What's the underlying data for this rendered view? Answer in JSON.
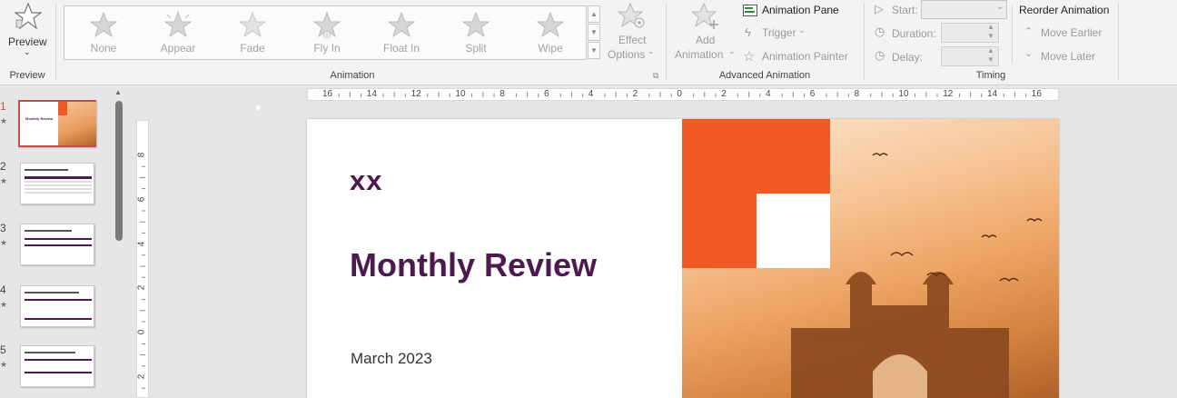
{
  "ribbon": {
    "preview": {
      "label": "Preview",
      "group": "Preview"
    },
    "animation": {
      "group": "Animation",
      "items": [
        {
          "label": "None"
        },
        {
          "label": "Appear"
        },
        {
          "label": "Fade"
        },
        {
          "label": "Fly In"
        },
        {
          "label": "Float In"
        },
        {
          "label": "Split"
        },
        {
          "label": "Wipe"
        }
      ],
      "effect_options": {
        "line1": "Effect",
        "line2": "Options"
      }
    },
    "advanced": {
      "group": "Advanced Animation",
      "add_animation": {
        "line1": "Add",
        "line2": "Animation"
      },
      "pane": "Animation Pane",
      "trigger": "Trigger",
      "painter": "Animation Painter"
    },
    "timing": {
      "group": "Timing",
      "start": "Start:",
      "duration": "Duration:",
      "delay": "Delay:",
      "start_value": "",
      "duration_value": "",
      "delay_value": ""
    },
    "reorder": {
      "title": "Reorder Animation",
      "earlier": "Move Earlier",
      "later": "Move Later"
    }
  },
  "thumbnails": [
    {
      "number": "1",
      "star": "★",
      "title": "Monthly Review",
      "selected": true
    },
    {
      "number": "2",
      "star": "★"
    },
    {
      "number": "3",
      "star": "★"
    },
    {
      "number": "4",
      "star": "★"
    },
    {
      "number": "5",
      "star": "★"
    }
  ],
  "rulers": {
    "h_ticks": [
      "16",
      "14",
      "12",
      "10",
      "8",
      "6",
      "4",
      "2",
      "0",
      "2",
      "4",
      "6",
      "8",
      "10",
      "12",
      "14",
      "16"
    ],
    "v_ticks": [
      "8",
      "6",
      "4",
      "2",
      "0",
      "2"
    ]
  },
  "slide": {
    "header": "xx",
    "title": "Monthly Review",
    "date": "March 2023",
    "accent_color": "#f15a24",
    "title_color": "#4d1a4f"
  }
}
